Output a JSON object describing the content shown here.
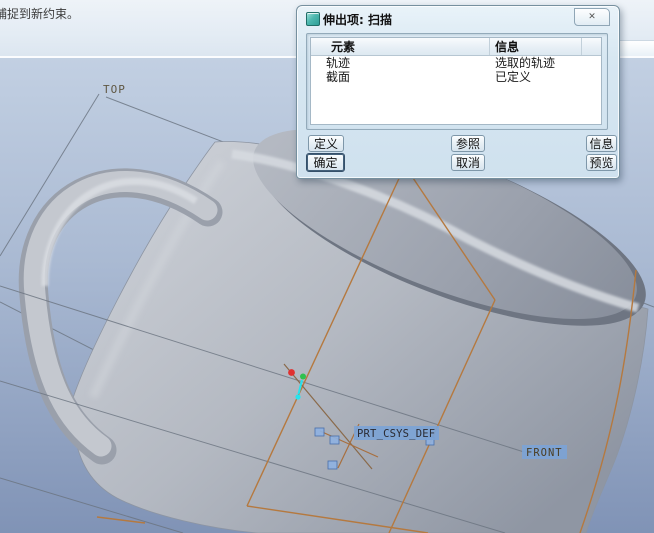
{
  "window": {
    "message": "捕捉到新约束。"
  },
  "dialog": {
    "title": "伸出项: 扫描",
    "close_glyph": "✕",
    "table": {
      "columns": [
        "元素",
        "信息"
      ],
      "rows": [
        {
          "element": "轨迹",
          "info": "选取的轨迹"
        },
        {
          "element": "截面",
          "info": "已定义"
        }
      ]
    },
    "buttons": {
      "define": "定义",
      "references": "参照",
      "info": "信息",
      "ok": "确定",
      "cancel": "取消",
      "preview": "预览"
    }
  },
  "viewport": {
    "labels": {
      "top_plane": "TOP",
      "front_plane": "FRONT",
      "csys": "PRT_CSYS_DEF"
    }
  },
  "colors": {
    "selection_highlight": "#7ba3d6",
    "sketch_line": "#b5793f",
    "marker_red": "#e03030",
    "marker_green": "#2ec14e",
    "marker_cyan": "#27e4ee",
    "datum_label_text": "#5f5742"
  }
}
